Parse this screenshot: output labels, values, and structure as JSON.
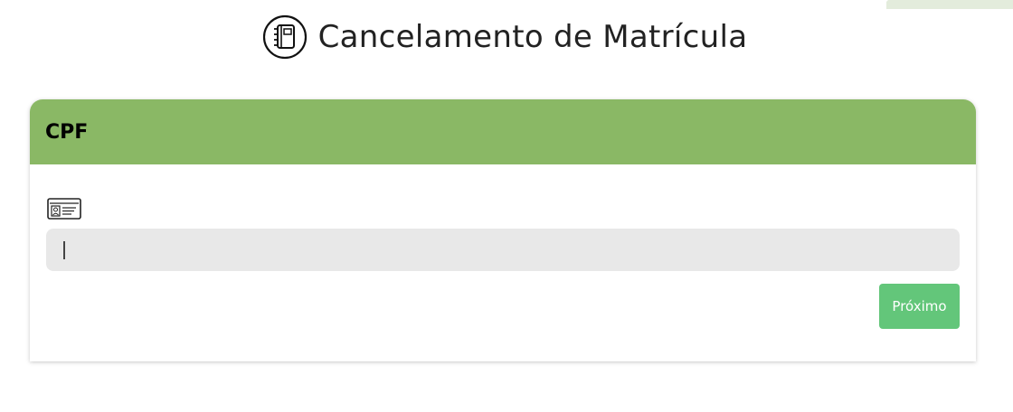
{
  "page": {
    "title": "Cancelamento de Matrícula",
    "title_icon": "notebook-icon"
  },
  "card": {
    "title": "CPF",
    "header_color": "#8ab865",
    "field_icon": "id-card-icon",
    "cpf_input": {
      "value": "",
      "placeholder": ""
    },
    "next_label": "Próximo",
    "next_color": "#63c67a"
  }
}
